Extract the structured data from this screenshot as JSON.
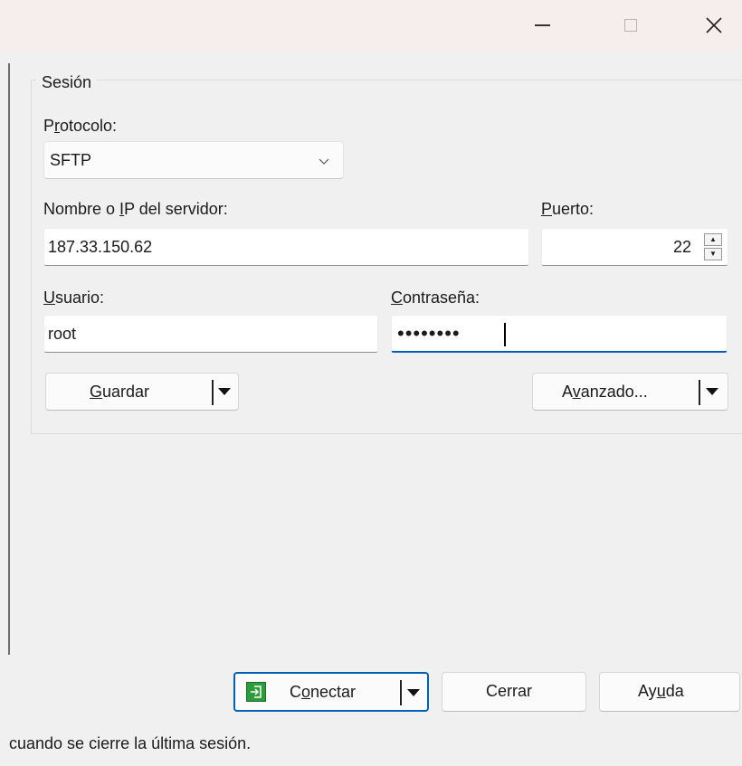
{
  "window": {
    "minimize_icon": "minimize-icon",
    "maximize_icon": "maximize-icon",
    "close_icon": "close-icon"
  },
  "session": {
    "legend": "Sesión",
    "protocol_label": "Protocolo:",
    "protocol_value": "SFTP",
    "host_label": "Nombre o IP del servidor:",
    "host_value": "187.33.150.62",
    "port_label": "Puerto:",
    "port_value": "22",
    "user_label": "Usuario:",
    "user_value": "root",
    "password_label": "Contraseña:",
    "password_masked": "••••••••",
    "save_button": "Guardar",
    "advanced_button": "Avanzado..."
  },
  "footer": {
    "connect_button": "Conectar",
    "close_button": "Cerrar",
    "help_button": "Ayuda"
  },
  "status_text": "cuando se cierre la última sesión.",
  "colors": {
    "accent": "#005fb8",
    "connect_icon": "#2d9c3c",
    "titlebar": "#f6eded",
    "client_bg": "#f0f0f0"
  }
}
